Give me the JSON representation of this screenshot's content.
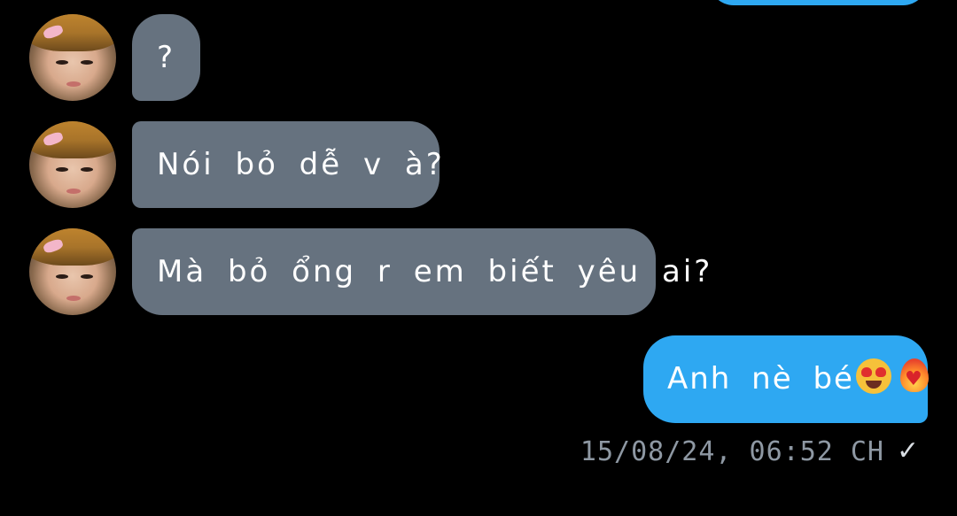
{
  "conversation": {
    "incoming": [
      {
        "text": "?"
      },
      {
        "text": "Nói bỏ dễ v à?"
      },
      {
        "text": "Mà bỏ ổng r em biết yêu ai?"
      }
    ],
    "outgoing": {
      "text": "Anh nè bé",
      "emojis": [
        "heart-eyes-emoji",
        "heart-on-fire-emoji"
      ]
    },
    "timestamp": "15/08/24, 06:52 CH",
    "status_icon": "check-icon",
    "status_glyph": "✓"
  },
  "colors": {
    "incoming_bubble": "#66727f",
    "outgoing_bubble": "#2ea8f2",
    "background": "#000000",
    "timestamp": "#8e98a3"
  }
}
